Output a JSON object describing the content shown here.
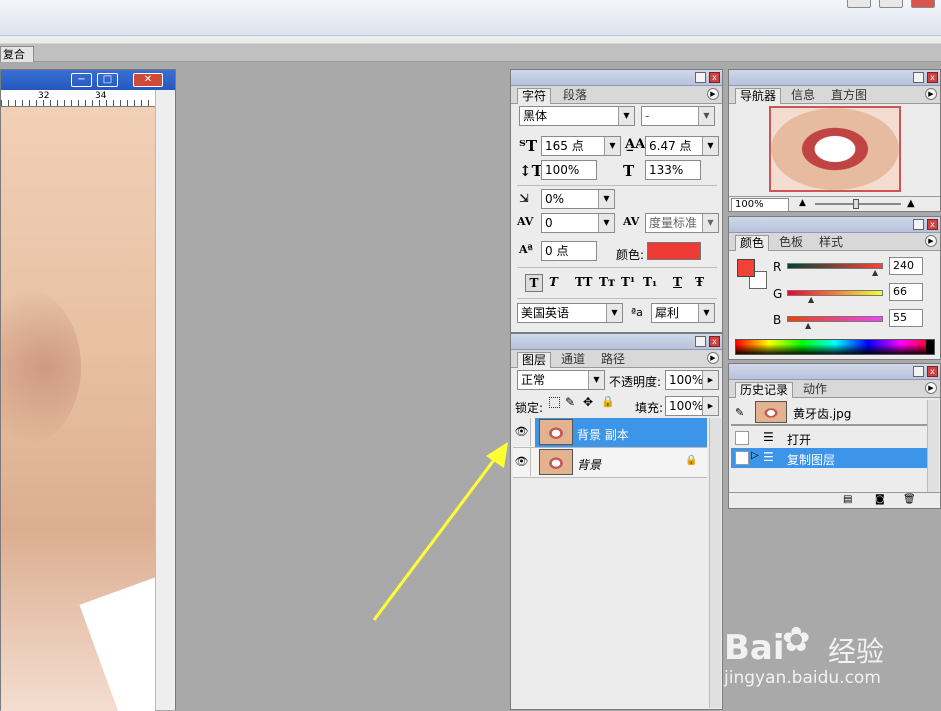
{
  "doc_tab": {
    "label": "复合"
  },
  "document": {
    "ruler_ticks": [
      "32",
      "34"
    ],
    "minimize": "−",
    "restore": "□",
    "close": "✕"
  },
  "character_panel": {
    "tabs": [
      "字符",
      "段落"
    ],
    "font_family": "黑体",
    "font_style": "-",
    "font_size": "165 点",
    "leading": "6.47 点",
    "vertical_scale": "100%",
    "horizontal_scale": "133%",
    "baseline_shift_pct": "0%",
    "kerning": "0",
    "tracking": "度量标准",
    "baseline_shift": "0 点",
    "color_label": "颜色:",
    "color_value": "#ef3b35",
    "style_buttons": [
      "T",
      "T",
      "TT",
      "Tт",
      "T¹",
      "T₁",
      "T",
      "Ŧ"
    ],
    "language": "美国英语",
    "antialias": "犀利"
  },
  "layers_panel": {
    "tabs": [
      "图层",
      "通道",
      "路径"
    ],
    "blend_mode": "正常",
    "opacity_label": "不透明度:",
    "opacity_value": "100%",
    "lock_label": "锁定:",
    "fill_label": "填充:",
    "fill_value": "100%",
    "layers": [
      {
        "name": "背景 副本",
        "selected": true,
        "locked": false
      },
      {
        "name": "背景",
        "selected": false,
        "locked": true
      }
    ]
  },
  "navigator_panel": {
    "tabs": [
      "导航器",
      "信息",
      "直方图"
    ],
    "zoom": "100%"
  },
  "color_panel": {
    "tabs": [
      "颜色",
      "色板",
      "样式"
    ],
    "channels": [
      {
        "label": "R",
        "value": "240",
        "fraction": 0.94
      },
      {
        "label": "G",
        "value": "66",
        "fraction": 0.26
      },
      {
        "label": "B",
        "value": "55",
        "fraction": 0.22
      }
    ],
    "foreground": "#f04237",
    "background": "#ffffff"
  },
  "history_panel": {
    "tabs": [
      "历史记录",
      "动作"
    ],
    "snapshot": "黄牙齿.jpg",
    "steps": [
      {
        "label": "打开",
        "selected": false
      },
      {
        "label": "复制图层",
        "selected": true
      }
    ]
  },
  "watermark": {
    "brand": "Bai",
    "brand2": "经验",
    "url": "jingyan.baidu.com"
  },
  "colors": {
    "selection": "#3d95ea",
    "arrow": "#ffff33"
  }
}
